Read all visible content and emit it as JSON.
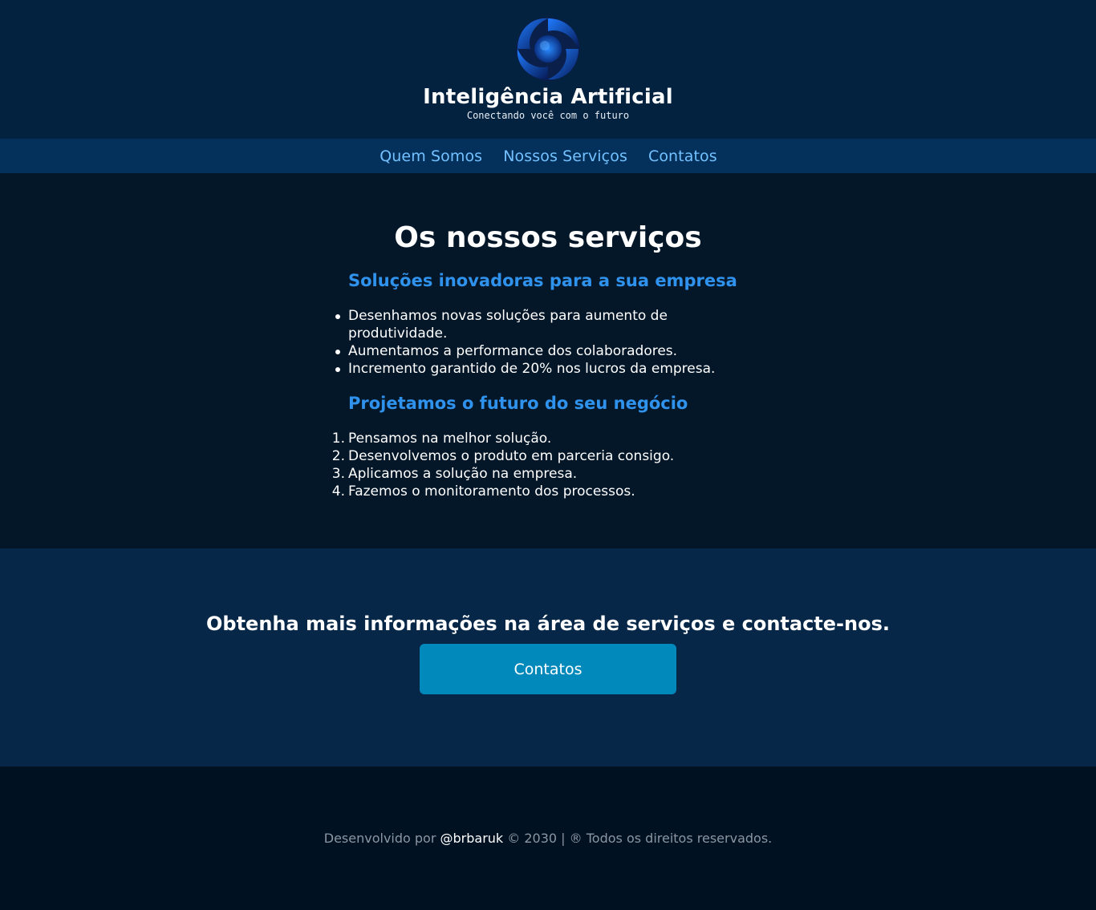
{
  "header": {
    "title": "Inteligência Artificial",
    "tagline": "Conectando você com o futuro",
    "logo_icon": "swirl-logo-icon"
  },
  "nav": {
    "items": [
      {
        "label": "Quem Somos"
      },
      {
        "label": "Nossos Serviços"
      },
      {
        "label": "Contatos"
      }
    ]
  },
  "services": {
    "title": "Os nossos serviços",
    "subtitle_1": "Soluções inovadoras para a sua empresa",
    "bullets": [
      "Desenhamos novas soluções para aumento de produtividade.",
      "Aumentamos a performance dos colaboradores.",
      "Incremento garantido de 20% nos lucros da empresa."
    ],
    "subtitle_2": "Projetamos o futuro do seu negócio",
    "steps": [
      {
        "num": "1.",
        "text": "Pensamos na melhor solução."
      },
      {
        "num": "2.",
        "text": "Desenvolvemos o produto em parceria consigo."
      },
      {
        "num": "3.",
        "text": "Aplicamos a solução na empresa."
      },
      {
        "num": "4.",
        "text": "Fazemos o monitoramento dos processos."
      }
    ]
  },
  "cta": {
    "text": "Obtenha mais informações na área de serviços e contacte-nos.",
    "button_label": "Contatos"
  },
  "footer": {
    "prefix": "Desenvolvido por ",
    "author": "@brbaruk",
    "suffix": " © 2030 | ® Todos os direitos reservados."
  },
  "colors": {
    "header_bg": "#032240",
    "nav_bg": "#04305c",
    "nav_link": "#73c2ff",
    "section_bg": "#041729",
    "subtitle": "#2f93ee",
    "cta_bg": "#072748",
    "button_bg": "#0289bb",
    "footer_bg": "#001121"
  }
}
